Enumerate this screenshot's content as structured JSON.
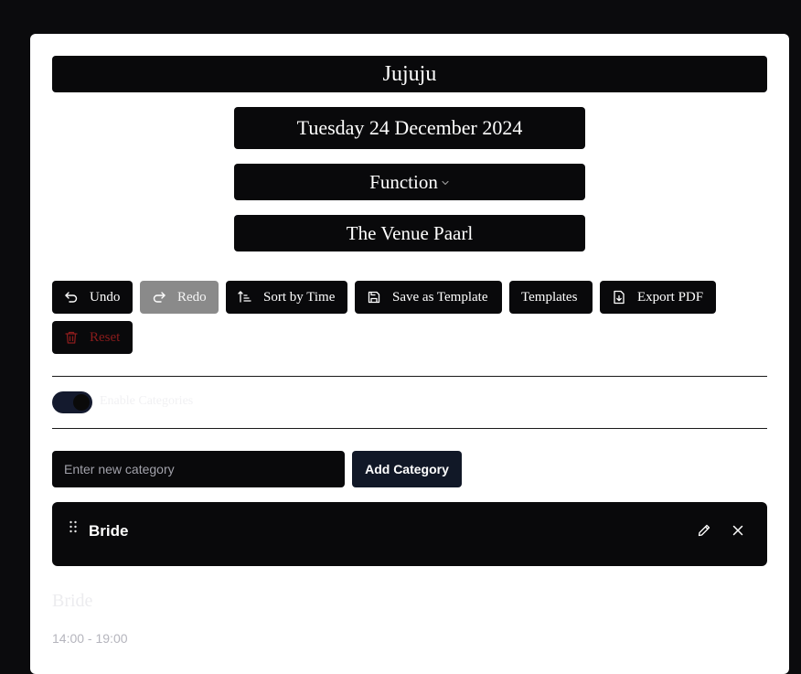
{
  "event": {
    "title": "Jujuju",
    "date": "Tuesday 24 December 2024",
    "type": "Function",
    "venue": "The Venue Paarl"
  },
  "toolbar": {
    "undo_label": "Undo",
    "redo_label": "Redo",
    "sort_label": "Sort by Time",
    "save_template_label": "Save as Template",
    "templates_label": "Templates",
    "export_label": "Export PDF",
    "reset_label": "Reset"
  },
  "categories_toggle": {
    "label": "Enable Categories",
    "enabled": true
  },
  "new_category": {
    "placeholder": "Enter new category",
    "value": "",
    "add_label": "Add Category"
  },
  "categories": [
    {
      "name": "Bride"
    }
  ],
  "section": {
    "heading": "Bride",
    "time_range": "14:00 - 19:00"
  },
  "icons": {
    "undo": "undo-icon",
    "redo": "redo-icon",
    "sort": "sort-ascending-icon",
    "save": "save-icon",
    "export": "file-download-icon",
    "reset": "trash-icon",
    "drag": "drag-handle-icon",
    "edit": "pencil-icon",
    "close": "close-icon",
    "dropdown": "chevron-down-icon"
  },
  "colors": {
    "page_bg": "#0b0b0d",
    "card_bg": "#ffffff",
    "dark_fill": "#09090b",
    "disabled_fill": "#8a8a8a",
    "danger_text": "#8b1c1c",
    "toggle_track": "#141a2e",
    "add_button": "#111827"
  }
}
